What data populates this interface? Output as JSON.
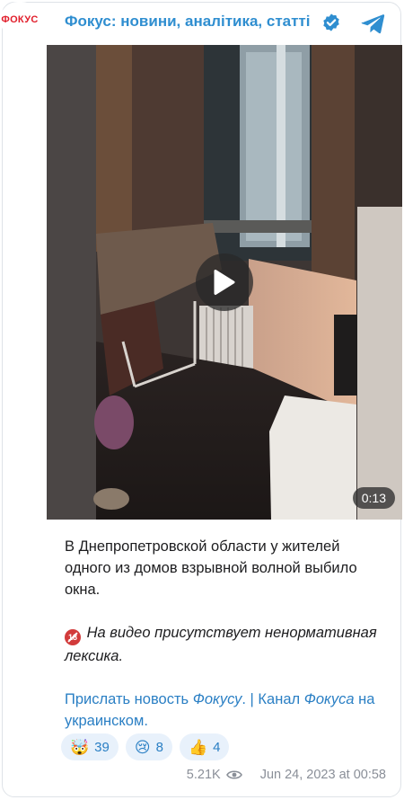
{
  "header": {
    "avatar_text": "ФОКУС",
    "channel_name": "Фокус: новини, аналітика, статті"
  },
  "video": {
    "duration": "0:13"
  },
  "post": {
    "line1": "В Днепропетровской области у жителей одного из домов взрывной волной выбило окна.",
    "warning_badge": "18",
    "warning_text": "На видео присутствует ненормативная лексика.",
    "link_part1": "Прислать новость",
    "link_part2": "Фокусу",
    "link_part3": ". | Канал",
    "link_part4": "Фокуса",
    "link_part5": "на украинском."
  },
  "reactions": [
    {
      "emoji": "🤯",
      "count": "39"
    },
    {
      "emoji": "😢",
      "count": "8"
    },
    {
      "emoji": "👍",
      "count": "4"
    }
  ],
  "meta": {
    "views": "5.21K",
    "timestamp": "Jun 24, 2023 at 00:58"
  },
  "colors": {
    "accent": "#2f8ed0",
    "brand_red": "#e11d2a",
    "reaction_bg": "#e8f1fb"
  },
  "icons": [
    "verified-icon",
    "telegram-icon",
    "play-icon",
    "eye-icon"
  ]
}
